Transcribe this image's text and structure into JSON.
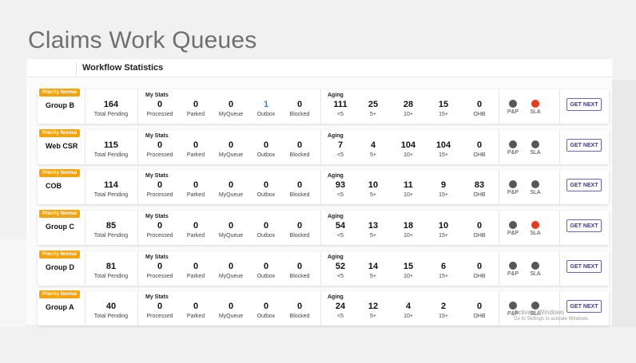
{
  "page": {
    "title": "Claims Work Queues"
  },
  "header": {
    "label": "Workflow Statistics"
  },
  "labels": {
    "my_stats": "My Stats",
    "aging": "Aging",
    "total_pending": "Total Pending",
    "processed": "Processed",
    "parked": "Parked",
    "myqueue": "MyQueue",
    "outbox": "Outbox",
    "blocked": "Blocked",
    "lt5": "<5",
    "g5": "5+",
    "g10": "10+",
    "g15": "15+",
    "ohb": "OHB",
    "pp": "P&P",
    "sla": "SLA",
    "get_next": "GET NEXT"
  },
  "colors": {
    "priority_badge": "#f5a30b",
    "status_gray": "#55595c",
    "status_red": "#e8391f",
    "link_blue": "#1b88d6",
    "button_border": "#6b62c8"
  },
  "rows": [
    {
      "priority": "Priority Normal",
      "name": "Group B",
      "total_pending": "164",
      "processed": "0",
      "parked": "0",
      "myqueue": "0",
      "outbox": "1",
      "blocked": "0",
      "lt5": "111",
      "g5": "25",
      "g10": "28",
      "g15": "15",
      "ohb": "0",
      "pp_status": "gray",
      "sla_status": "red"
    },
    {
      "priority": "Priority Normal",
      "name": "Web CSR",
      "total_pending": "115",
      "processed": "0",
      "parked": "0",
      "myqueue": "0",
      "outbox": "0",
      "blocked": "0",
      "lt5": "7",
      "g5": "4",
      "g10": "104",
      "g15": "104",
      "ohb": "0",
      "pp_status": "gray",
      "sla_status": "gray"
    },
    {
      "priority": "Priority Normal",
      "name": "COB",
      "total_pending": "114",
      "processed": "0",
      "parked": "0",
      "myqueue": "0",
      "outbox": "0",
      "blocked": "0",
      "lt5": "93",
      "g5": "10",
      "g10": "11",
      "g15": "9",
      "ohb": "83",
      "pp_status": "gray",
      "sla_status": "gray"
    },
    {
      "priority": "Priority Normal",
      "name": "Group C",
      "total_pending": "85",
      "processed": "0",
      "parked": "0",
      "myqueue": "0",
      "outbox": "0",
      "blocked": "0",
      "lt5": "54",
      "g5": "13",
      "g10": "18",
      "g15": "10",
      "ohb": "0",
      "pp_status": "gray",
      "sla_status": "red"
    },
    {
      "priority": "Priority Normal",
      "name": "Group D",
      "total_pending": "81",
      "processed": "0",
      "parked": "0",
      "myqueue": "0",
      "outbox": "0",
      "blocked": "0",
      "lt5": "52",
      "g5": "14",
      "g10": "15",
      "g15": "6",
      "ohb": "0",
      "pp_status": "gray",
      "sla_status": "gray"
    },
    {
      "priority": "Priority Normal",
      "name": "Group A",
      "total_pending": "40",
      "processed": "0",
      "parked": "0",
      "myqueue": "0",
      "outbox": "0",
      "blocked": "0",
      "lt5": "24",
      "g5": "12",
      "g10": "4",
      "g15": "2",
      "ohb": "0",
      "pp_status": "gray",
      "sla_status": "gray"
    }
  ],
  "watermark": {
    "line1": "Activate Windows",
    "line2": "Go to Settings to activate Windows."
  }
}
